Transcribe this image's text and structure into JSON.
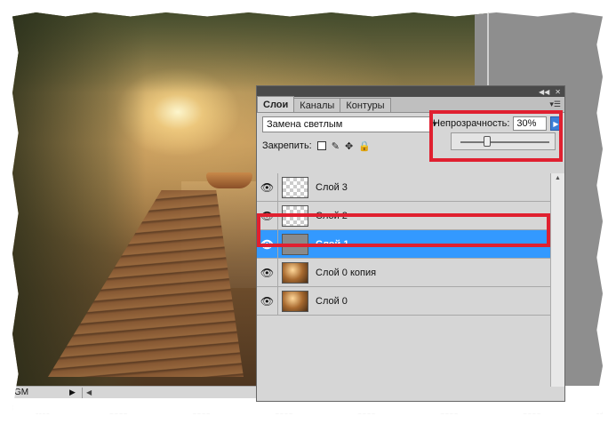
{
  "panel": {
    "tabs": [
      {
        "label": "Слои",
        "active": true
      },
      {
        "label": "Каналы",
        "active": false
      },
      {
        "label": "Контуры",
        "active": false
      }
    ],
    "blend_mode": "Замена светлым",
    "opacity_label": "Непрозрачность:",
    "opacity_value": "30%",
    "opacity_fraction": 0.3,
    "lock_label": "Закрепить:",
    "layers": [
      {
        "name": "Слой 3",
        "thumb": "transparent",
        "selected": false,
        "visible": true
      },
      {
        "name": "Слой 2",
        "thumb": "transparent",
        "selected": false,
        "visible": true
      },
      {
        "name": "Слой 1",
        "thumb": "gray",
        "selected": true,
        "visible": true
      },
      {
        "name": "Слой 0 копия",
        "thumb": "photo",
        "selected": false,
        "visible": true
      },
      {
        "name": "Слой 0",
        "thumb": "photo",
        "selected": false,
        "visible": true
      }
    ]
  },
  "statusbar": {
    "zoom_text": "GM"
  },
  "colors": {
    "selected_layer": "#3399ff",
    "highlight": "#e02030"
  }
}
